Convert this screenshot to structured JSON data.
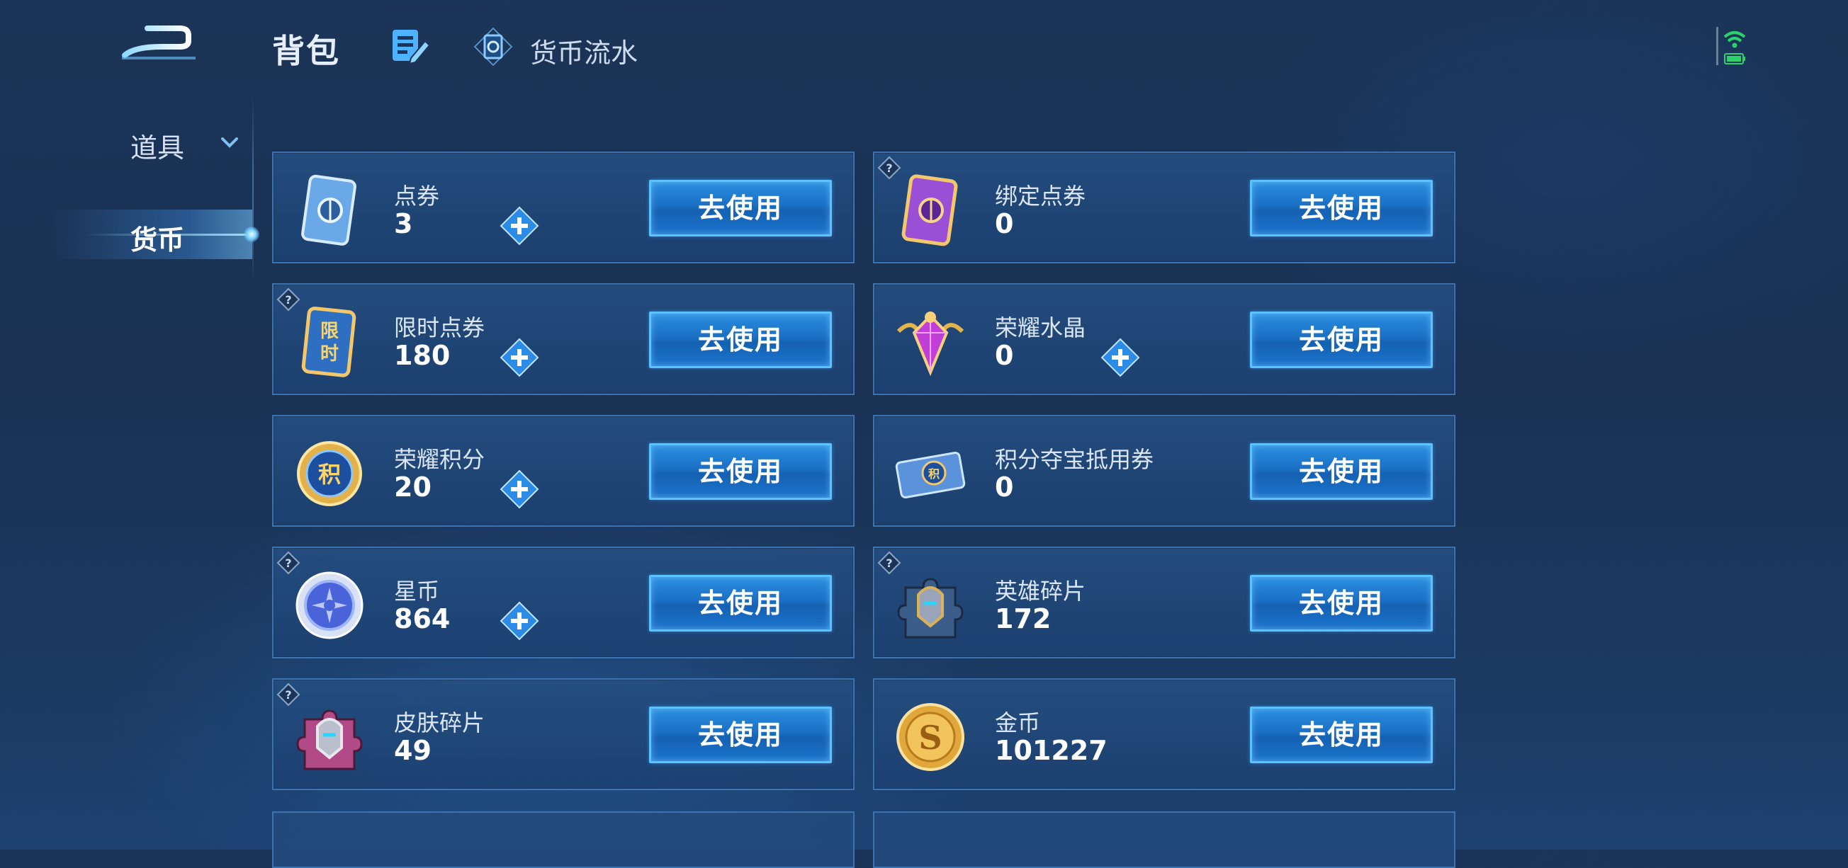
{
  "header": {
    "back_icon": "back-arrow-icon",
    "title": "背包",
    "edit_icon": "edit-list-icon",
    "flow_icon": "currency-card-icon",
    "flow_label": "货币流水",
    "status_icon": "wifi-battery-icon"
  },
  "sidebar": {
    "items": [
      {
        "label": "道具",
        "expanded": false,
        "icon": "chevron-down-icon"
      },
      {
        "label": "货币",
        "selected": true
      }
    ]
  },
  "currencies": [
    {
      "name": "点券",
      "count": "3",
      "has_plus": true,
      "has_help": false,
      "icon": "coupon-icon",
      "button": "去使用"
    },
    {
      "name": "绑定点券",
      "count": "0",
      "has_plus": false,
      "has_help": true,
      "icon": "bound-coupon-icon",
      "button": "去使用"
    },
    {
      "name": "限时点券",
      "count": "180",
      "has_plus": true,
      "has_help": true,
      "icon": "limited-coupon-icon",
      "button": "去使用"
    },
    {
      "name": "荣耀水晶",
      "count": "0",
      "has_plus": true,
      "has_help": false,
      "icon": "glory-crystal-icon",
      "button": "去使用"
    },
    {
      "name": "荣耀积分",
      "count": "20",
      "has_plus": true,
      "has_help": false,
      "icon": "glory-points-icon",
      "button": "去使用"
    },
    {
      "name": "积分夺宝抵用券",
      "count": "0",
      "has_plus": false,
      "has_help": false,
      "icon": "points-voucher-icon",
      "button": "去使用"
    },
    {
      "name": "星币",
      "count": "864",
      "has_plus": true,
      "has_help": true,
      "icon": "star-coin-icon",
      "button": "去使用"
    },
    {
      "name": "英雄碎片",
      "count": "172",
      "has_plus": false,
      "has_help": true,
      "icon": "hero-fragment-icon",
      "button": "去使用"
    },
    {
      "name": "皮肤碎片",
      "count": "49",
      "has_plus": false,
      "has_help": true,
      "icon": "skin-fragment-icon",
      "button": "去使用"
    },
    {
      "name": "金币",
      "count": "101227",
      "has_plus": false,
      "has_help": false,
      "icon": "gold-coin-icon",
      "button": "去使用"
    }
  ],
  "colors": {
    "background": "#1b3457",
    "card_border": "#4882c4",
    "button_fill": "#1a6fc4",
    "button_border": "#5cc2ff",
    "plus_blue": "#2b8be6"
  }
}
